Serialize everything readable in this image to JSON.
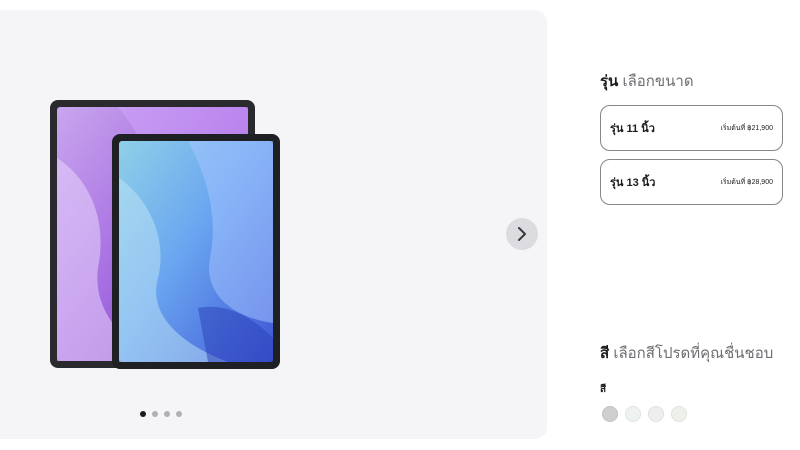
{
  "gallery": {
    "next_icon": "chevron-right-icon",
    "dot_count": 4,
    "active_dot": 1
  },
  "size_section": {
    "title_strong": "รุ่น",
    "title_muted": " เลือกขนาด",
    "models": [
      {
        "name": "รุ่น 11 นิ้ว",
        "price": "เริ่มต้นที่ ฿21,900"
      },
      {
        "name": "รุ่น 13 นิ้ว",
        "price": "เริ่มต้นที่ ฿28,900"
      }
    ]
  },
  "color_section": {
    "title_strong": "สี",
    "title_muted": " เลือกสีโปรดที่คุณชื่นชอบ",
    "label": "สี",
    "swatches": [
      "#cfcfd1",
      "#eef2f1",
      "#eeeeef",
      "#eef1ea"
    ]
  }
}
